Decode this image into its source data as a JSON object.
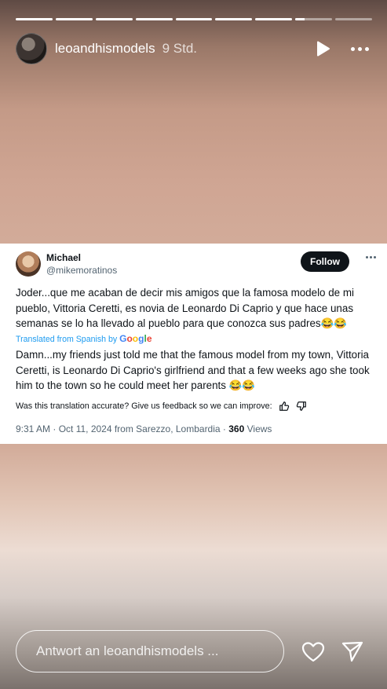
{
  "story": {
    "progress": [
      1,
      1,
      1,
      1,
      1,
      1,
      1,
      0.25,
      0
    ],
    "username": "leoandhismodels",
    "time": "9 Std."
  },
  "tweet": {
    "name": "Michael",
    "handle": "@mikemoratinos",
    "follow_label": "Follow",
    "text": "Joder...que me acaban de decir mis amigos que la famosa modelo de mi pueblo, Vittoria Ceretti, es novia de Leonardo Di Caprio y que hace unas semanas se lo ha llevado al pueblo para que conozca sus padres😂😂",
    "translated_prefix": "Translated from Spanish by",
    "translated_brand": "Google",
    "translation": "Damn...my friends just told me that the famous model from my town, Vittoria Ceretti, is Leonardo Di Caprio's girlfriend and that a few weeks ago she took him to the town so he could meet her parents 😂😂",
    "feedback_prompt": "Was this translation accurate? Give us feedback so we can improve:",
    "meta_date": "9:31 AM · Oct 11, 2024 from Sarezzo, Lombardia ·",
    "views_count": "360",
    "views_label": "Views"
  },
  "reply": {
    "placeholder": "Antwort an leoandhismodels ..."
  },
  "icons": {
    "play": "play-icon",
    "more": "more-icon",
    "heart": "heart-icon",
    "send": "send-icon",
    "thumb_up": "thumbs-up-icon",
    "thumb_down": "thumbs-down-icon"
  }
}
